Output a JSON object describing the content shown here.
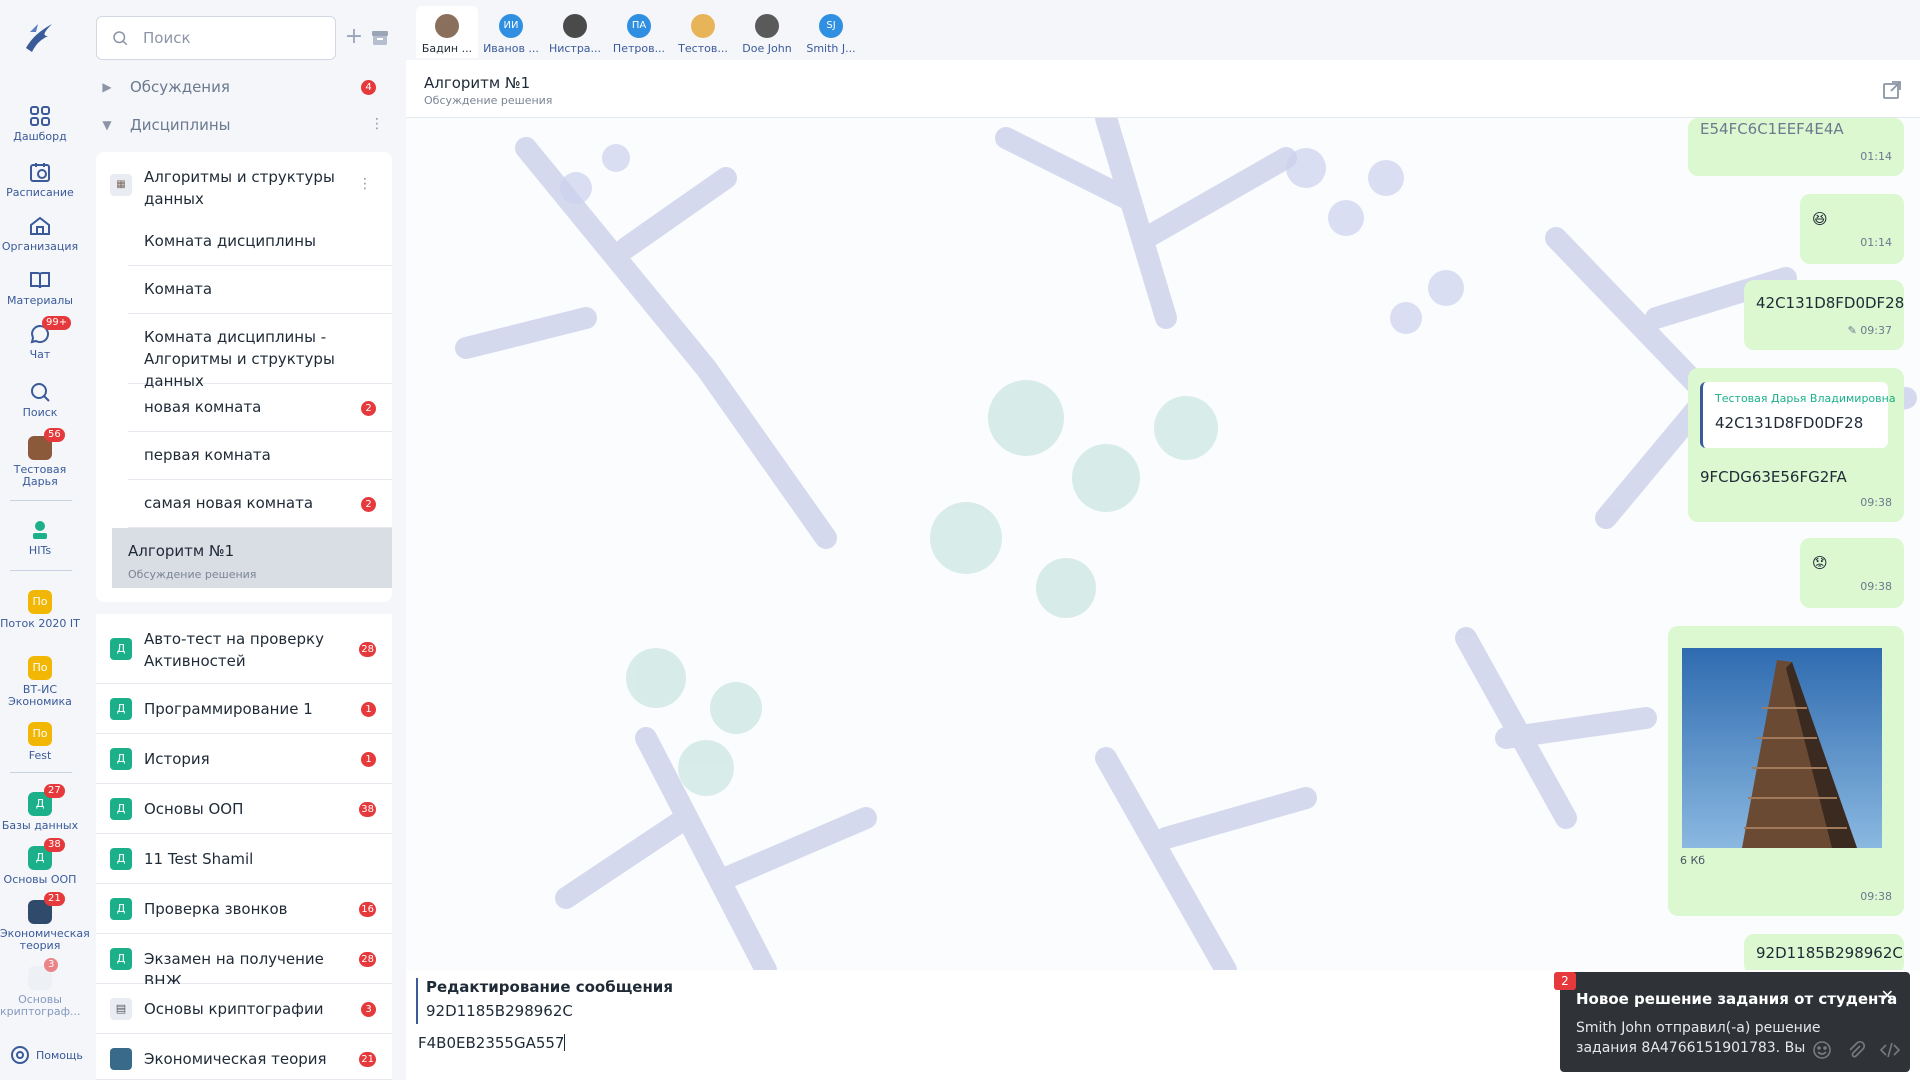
{
  "rail": {
    "items": [
      {
        "label": "Дашборд",
        "icon": "dashboard-icon"
      },
      {
        "label": "Расписание",
        "icon": "schedule-icon"
      },
      {
        "label": "Организация",
        "icon": "organization-icon"
      },
      {
        "label": "Материалы",
        "icon": "book-icon"
      },
      {
        "label": "Чат",
        "icon": "chat-icon",
        "badge": "99+"
      },
      {
        "label": "Поиск",
        "icon": "search-icon"
      },
      {
        "label": "Тестовая Дарья",
        "icon": "avatar",
        "badge": "56"
      }
    ],
    "hits_label": "HITs",
    "groups": [
      {
        "avatar": "По",
        "label": "Поток 2020 IT"
      },
      {
        "avatar": "По",
        "label": "ВТ-ИС Экономика"
      },
      {
        "avatar": "По",
        "label": "Fest"
      }
    ],
    "courses": [
      {
        "avatar": "Д",
        "label": "Базы данных",
        "badge": "27"
      },
      {
        "avatar": "Д",
        "label": "Основы ООП",
        "badge": "38"
      },
      {
        "avatar": "",
        "label": "Экономическая теория",
        "badge": "21"
      },
      {
        "avatar": "",
        "label": "Основы криптограф...",
        "badge": "3"
      }
    ],
    "help_label": "Помощь"
  },
  "sidebar": {
    "search_placeholder": "Поиск",
    "sections": [
      {
        "label": "Обсуждения",
        "badge": "4"
      },
      {
        "label": "Дисциплины"
      }
    ],
    "expanded": {
      "title": "Алгоритмы и структуры данных",
      "rooms": [
        {
          "label": "Комната дисциплины"
        },
        {
          "label": "Комната"
        },
        {
          "label": "Комната дисциплины - Алгоритмы и структуры данных"
        },
        {
          "label": "новая комната",
          "badge": "2"
        },
        {
          "label": "первая комната"
        },
        {
          "label": "самая новая комната",
          "badge": "2"
        },
        {
          "label": "Алгоритм №1",
          "sub": "Обсуждение решения"
        }
      ]
    },
    "disciplines": [
      {
        "avatar": "Д",
        "label": "Авто-тест на проверку Активностей",
        "badge": "28"
      },
      {
        "avatar": "Д",
        "label": "Программирование 1",
        "badge": "1"
      },
      {
        "avatar": "Д",
        "label": "История",
        "badge": "1"
      },
      {
        "avatar": "Д",
        "label": "Основы ООП",
        "badge": "38"
      },
      {
        "avatar": "Д",
        "label": "11 Test Shamil"
      },
      {
        "avatar": "Д",
        "label": "Проверка звонков",
        "badge": "16"
      },
      {
        "avatar": "Д",
        "label": "Экзамен на получение ВНЖ",
        "badge": "28"
      },
      {
        "avatar": "",
        "label": "Основы криптографии",
        "badge": "3"
      },
      {
        "avatar": "",
        "label": "Экономическая теория",
        "badge": "21"
      }
    ]
  },
  "participants": [
    {
      "name": "Бадин ...",
      "initials": "",
      "color": "#8a6f5c"
    },
    {
      "name": "Иванов ...",
      "initials": "ИИ",
      "color": "#2f8fe0"
    },
    {
      "name": "Нистра...",
      "initials": "",
      "color": "#4a4a4a"
    },
    {
      "name": "Петров...",
      "initials": "ПА",
      "color": "#2f8fe0"
    },
    {
      "name": "Тестов...",
      "initials": "",
      "color": "#e8b45a"
    },
    {
      "name": "Doe John",
      "initials": "",
      "color": "#5a5a5a"
    },
    {
      "name": "Smith J...",
      "initials": "SJ",
      "color": "#2f8fe0"
    }
  ],
  "chat": {
    "title": "Алгоритм №1",
    "subtitle": "Обсуждение решения",
    "messages": [
      {
        "text": "E54FC6C1EEF4E4A",
        "time": "01:14"
      },
      {
        "text": "😆",
        "time": "01:14"
      },
      {
        "text": "42C131D8FD0DF28",
        "time": "09:37",
        "edited": "✎"
      },
      {
        "quote_author": "Тестовая Дарья Владимировна",
        "quote_text": "42C131D8FD0DF28",
        "text": "9FCDG63E56FG2FA",
        "time": "09:38"
      },
      {
        "text": "😟",
        "time": "09:38"
      },
      {
        "file_size": "6 Кб",
        "time": "09:38"
      },
      {
        "text": "92D1185B298962C"
      }
    ],
    "editing_title": "Редактирование сообщения",
    "editing_value": "92D1185B298962C",
    "input_value": "F4B0EB2355GA557"
  },
  "toast": {
    "badge": "2",
    "title": "Новое решение задания от студента",
    "body": "Smith John отправил(-а) решение задания 8A4766151901783. Вы"
  },
  "colors": {
    "accent": "#3a5a99",
    "bubble": "#dcf8d0",
    "badge": "#e5393b",
    "discipline": "#1bb08a"
  }
}
